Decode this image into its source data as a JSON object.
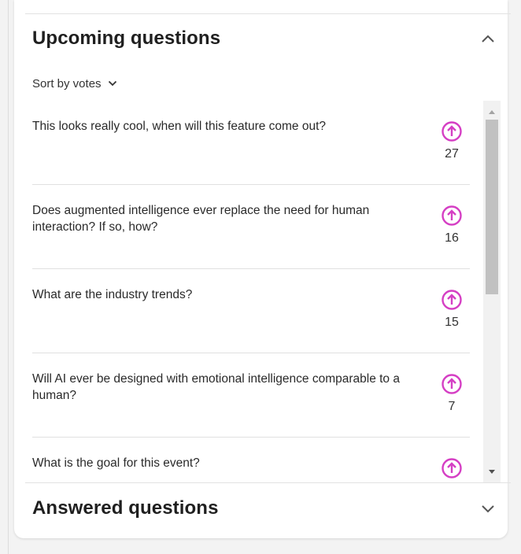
{
  "upcoming": {
    "title": "Upcoming questions",
    "sort_label": "Sort by votes",
    "questions": [
      {
        "text": "This looks really cool, when will this feature come out?",
        "votes": "27"
      },
      {
        "text": "Does augmented intelligence ever replace the need for human interaction? If so, how?",
        "votes": "16"
      },
      {
        "text": "What are the industry trends?",
        "votes": "15"
      },
      {
        "text": "Will AI ever be designed with emotional intelligence comparable to a human?",
        "votes": "7"
      },
      {
        "text": "What is the goal for this event?",
        "votes": ""
      }
    ]
  },
  "answered": {
    "title": "Answered questions"
  },
  "colors": {
    "accent": "#d53fc4",
    "scroll_thumb": "#c1c1c1"
  },
  "icons": {
    "collapse": "chevron-up-icon",
    "expand": "chevron-down-icon",
    "sort": "chevron-down-icon",
    "upvote": "upvote-circle-icon"
  }
}
